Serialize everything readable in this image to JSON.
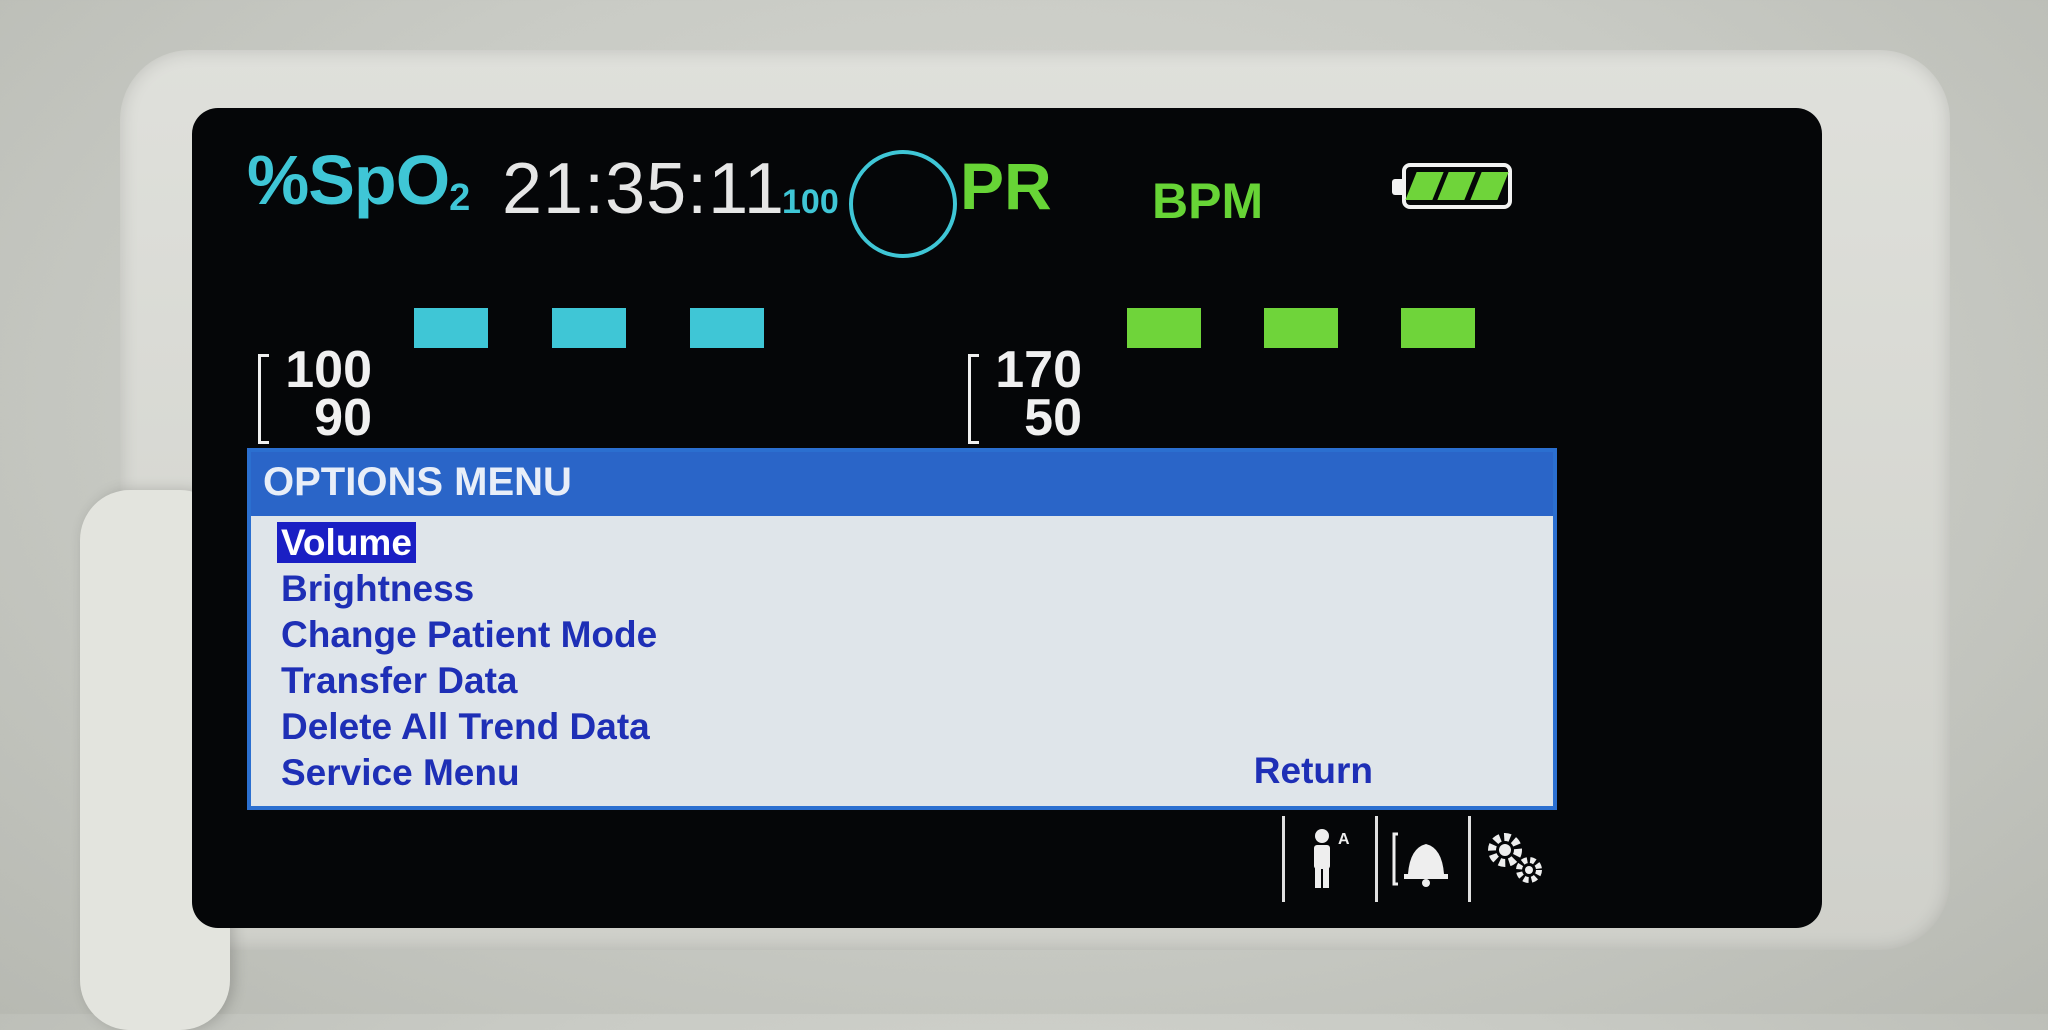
{
  "status_bar": {
    "spo2_label": "%SpO",
    "spo2_sub": "2",
    "time": "21:35:11",
    "pulse_amplitude": "100",
    "pr_label": "PR",
    "bpm_label": "BPM",
    "battery_level": 1.0
  },
  "readings": {
    "spo2_value": "---",
    "pr_value": "---"
  },
  "alarm_limits": {
    "spo2_high": "100",
    "spo2_low": "90",
    "pr_high": "170",
    "pr_low": "50"
  },
  "options_menu": {
    "title": "OPTIONS MENU",
    "items": [
      {
        "label": "Volume",
        "selected": true
      },
      {
        "label": "Brightness",
        "selected": false
      },
      {
        "label": "Change Patient Mode",
        "selected": false
      },
      {
        "label": "Transfer Data",
        "selected": false
      },
      {
        "label": "Delete All Trend Data",
        "selected": false
      },
      {
        "label": "Service Menu",
        "selected": false
      }
    ],
    "return_label": "Return"
  },
  "softkeys": [
    "patient-mode-icon",
    "alarm-bell-icon",
    "settings-gears-icon"
  ],
  "hardware_keys": [
    "waveform-icon",
    "display-icon",
    "ecg-trace-icon",
    "sensor-icon",
    "hand-touch-icon",
    "help-icon"
  ],
  "colors": {
    "spo2": "#3fc6d6",
    "pr": "#6fd43a",
    "menu_header": "#2a65c8",
    "menu_text": "#1e2fb6"
  }
}
